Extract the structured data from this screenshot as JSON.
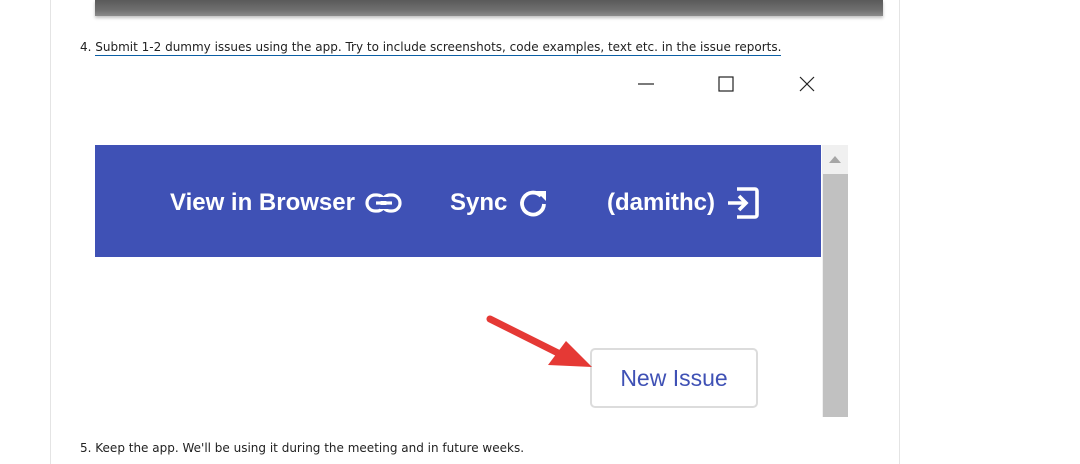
{
  "document": {
    "steps": [
      {
        "number": "4.",
        "text": "Submit 1-2 dummy issues using the app. Try to include screenshots, code examples, text etc. in the issue reports."
      },
      {
        "number": "5.",
        "text": "Keep the app. We'll be using it during the meeting and in future weeks."
      }
    ]
  },
  "window_controls": {
    "icons": [
      "minimize-icon",
      "maximize-icon",
      "close-icon"
    ]
  },
  "app_header": {
    "background_color": "#3f51b5",
    "items": [
      {
        "label": "View in Browser",
        "icon": "link-icon"
      },
      {
        "label": "Sync",
        "icon": "refresh-icon"
      },
      {
        "label": "(damithc)",
        "icon": "sign-in-icon"
      }
    ]
  },
  "main": {
    "new_issue_label": "New Issue",
    "accent_color": "#3f51b5"
  },
  "annotation": {
    "arrow_color": "#e53935"
  }
}
